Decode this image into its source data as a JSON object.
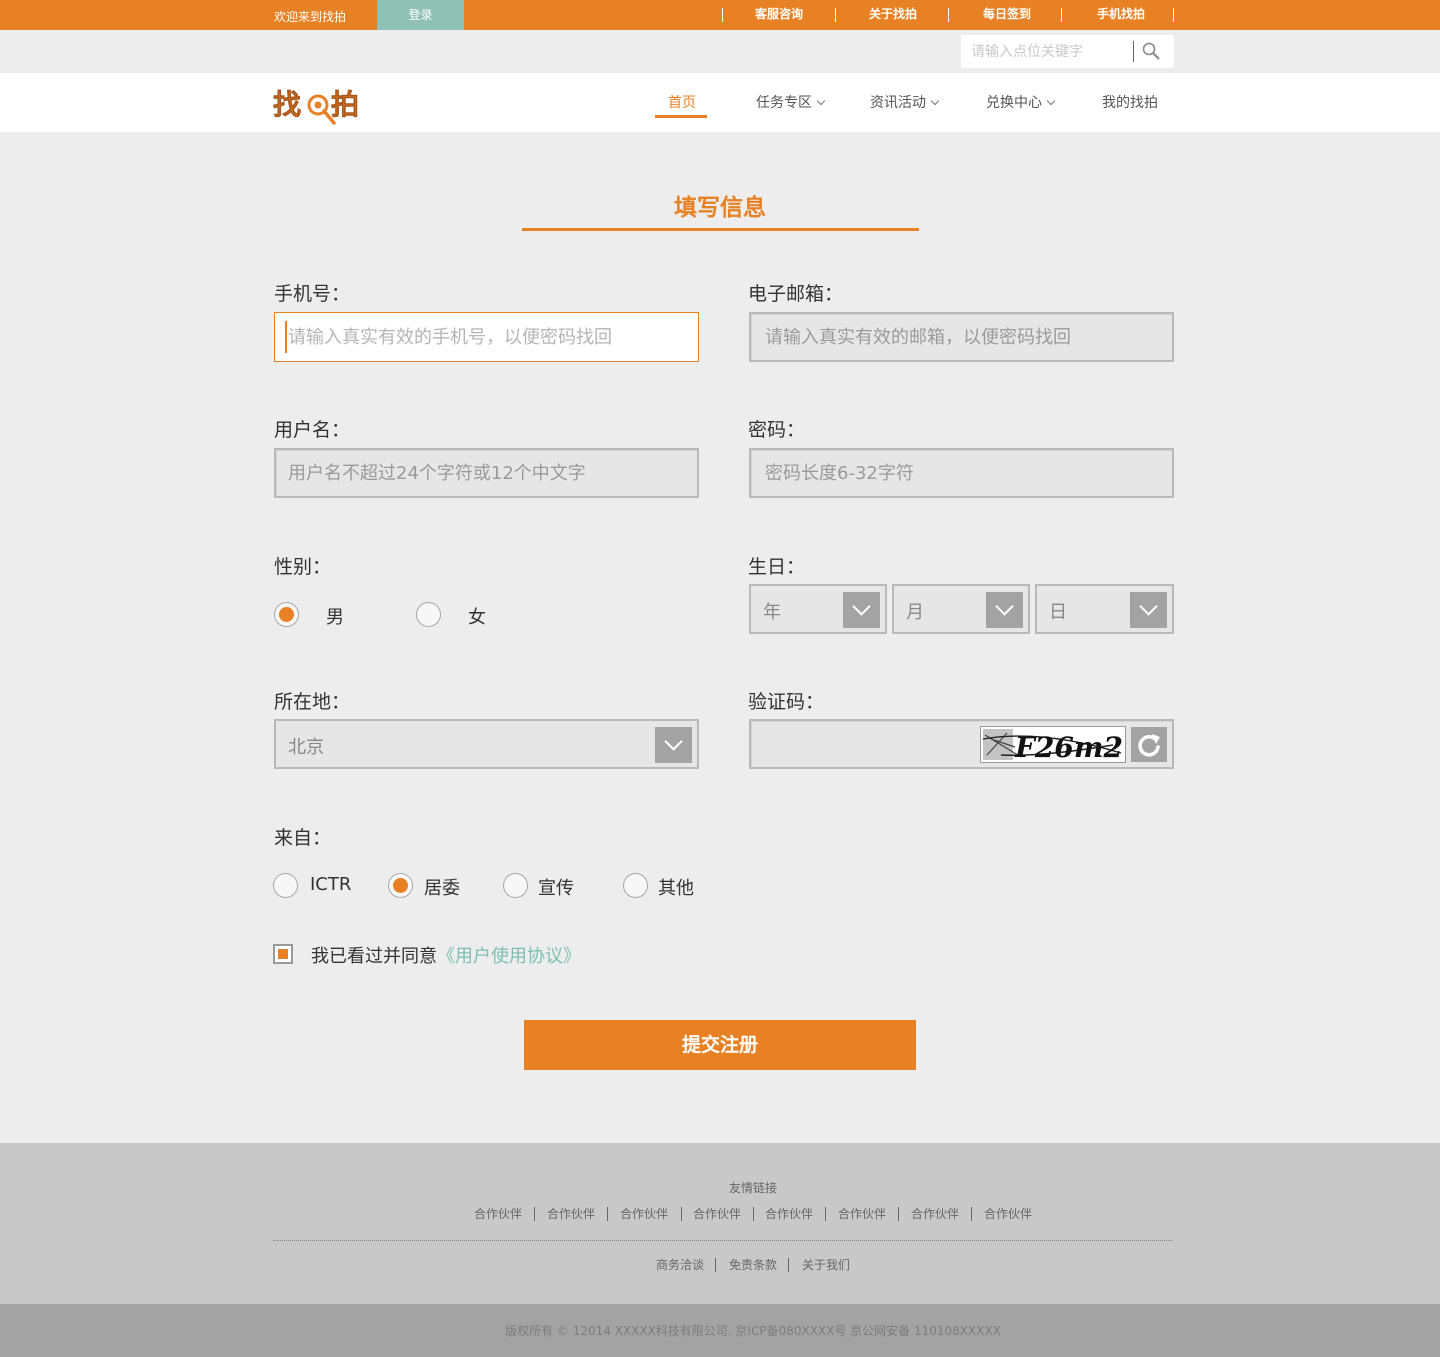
{
  "topbar": {
    "welcome": "欢迎来到找拍",
    "login": "登录",
    "links": [
      "客服咨询",
      "关于找拍",
      "每日签到",
      "手机找拍"
    ]
  },
  "search": {
    "placeholder": "请输入点位关键字",
    "icon": "search-icon"
  },
  "nav": {
    "logo_text": "找拍",
    "items": [
      {
        "label": "首页",
        "active": true
      },
      {
        "label": "任务专区",
        "dropdown": true
      },
      {
        "label": "资讯活动",
        "dropdown": true
      },
      {
        "label": "兑换中心",
        "dropdown": true
      },
      {
        "label": "我的找拍"
      }
    ]
  },
  "form": {
    "title": "填写信息",
    "phone": {
      "label": "手机号：",
      "placeholder": "请输入真实有效的手机号，以便密码找回"
    },
    "email": {
      "label": "电子邮箱：",
      "placeholder": "请输入真实有效的邮箱，以便密码找回"
    },
    "username": {
      "label": "用户名：",
      "placeholder": "用户名不超过24个字符或12个中文字"
    },
    "password": {
      "label": "密码：",
      "placeholder": "密码长度6-32字符"
    },
    "gender": {
      "label": "性别：",
      "options": [
        "男",
        "女"
      ],
      "selected": "男"
    },
    "birthday": {
      "label": "生日：",
      "year": "年",
      "month": "月",
      "day": "日"
    },
    "location": {
      "label": "所在地：",
      "value": "北京"
    },
    "captcha": {
      "label": "验证码：",
      "image_text": "F26m2"
    },
    "source": {
      "label": "来自：",
      "options": [
        "ICTR",
        "居委",
        "宣传",
        "其他"
      ],
      "selected": "居委"
    },
    "agree": {
      "text": "我已看过并同意",
      "link": "《用户使用协议》",
      "checked": true
    },
    "submit": "提交注册"
  },
  "footer": {
    "friend_title": "友情链接",
    "partners": [
      "合作伙伴",
      "合作伙伴",
      "合作伙伴",
      "合作伙伴",
      "合作伙伴",
      "合作伙伴",
      "合作伙伴",
      "合作伙伴"
    ],
    "links": [
      "商务洽谈",
      "免责条款",
      "关于我们"
    ],
    "copyright": "版权所有 © 12014 XXXXX科技有限公司. 京ICP备080XXXX号 京公网安备 110108XXXXX"
  },
  "colors": {
    "accent": "#e88124",
    "teal": "#8fc1b5",
    "link": "#7cc0b0"
  }
}
